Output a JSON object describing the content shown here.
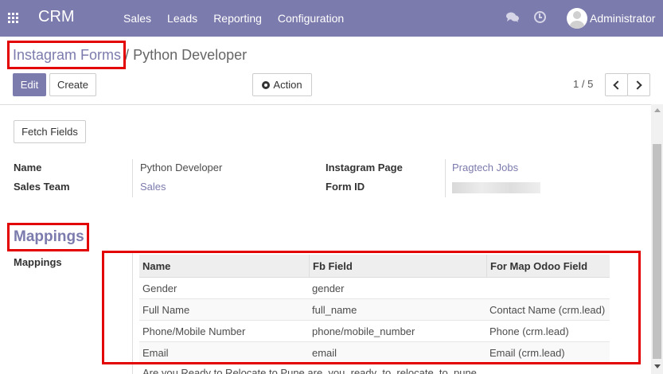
{
  "navbar": {
    "brand": "CRM",
    "menu": [
      "Sales",
      "Leads",
      "Reporting",
      "Configuration"
    ],
    "user": "Administrator"
  },
  "breadcrumb": {
    "parent": "Instagram Forms",
    "separator": "/",
    "current": "Python Developer"
  },
  "buttons": {
    "edit": "Edit",
    "create": "Create",
    "action": "Action",
    "fetch_fields": "Fetch Fields"
  },
  "pager": {
    "value": "1 / 5"
  },
  "form": {
    "name_label": "Name",
    "name_value": "Python Developer",
    "sales_team_label": "Sales Team",
    "sales_team_value": "Sales",
    "instagram_page_label": "Instagram Page",
    "instagram_page_value": "Pragtech Jobs",
    "form_id_label": "Form ID",
    "section_title": "Mappings",
    "mappings_label": "Mappings"
  },
  "table": {
    "headers": [
      "Name",
      "Fb Field",
      "For Map Odoo Field"
    ],
    "rows": [
      [
        "Gender",
        "gender",
        ""
      ],
      [
        "Full Name",
        "full_name",
        "Contact Name (crm.lead)"
      ],
      [
        "Phone/Mobile Number",
        "phone/mobile_number",
        "Phone (crm.lead)"
      ],
      [
        "Email",
        "email",
        "Email (crm.lead)"
      ]
    ],
    "partial_row": "Are you Ready to Relocate to Pune   are_you_ready_to_relocate_to_pune"
  },
  "colors": {
    "brand": "#7c7bad",
    "highlight": "#e30000"
  }
}
